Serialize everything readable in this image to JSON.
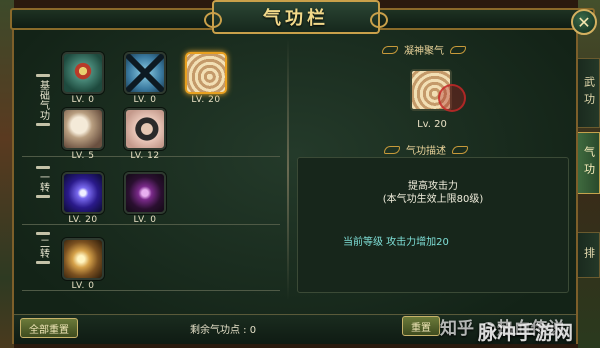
{
  "window": {
    "title": "气功栏",
    "close_icon": "close-icon"
  },
  "left": {
    "sections": [
      {
        "label": "基础气功",
        "skills": [
          {
            "level": "LV. 0",
            "icon": "shield-cross-icon",
            "selected": false
          },
          {
            "level": "LV. 0",
            "icon": "crossed-blades-icon",
            "selected": false
          },
          {
            "level": "LV. 20",
            "icon": "swirl-hand-icon",
            "selected": true
          },
          {
            "level": "LV. 5",
            "icon": "sleeping-figure-icon",
            "selected": false
          },
          {
            "level": "LV. 12",
            "icon": "warrior-portrait-icon",
            "selected": false
          }
        ]
      },
      {
        "label": "一转",
        "skills": [
          {
            "level": "LV. 20",
            "icon": "blue-energy-burst-icon",
            "selected": false
          },
          {
            "level": "LV. 0",
            "icon": "purple-claw-icon",
            "selected": false
          }
        ]
      },
      {
        "label": "二转",
        "skills": [
          {
            "level": "LV. 0",
            "icon": "golden-glow-icon",
            "selected": false
          }
        ]
      }
    ]
  },
  "right": {
    "header_selected": "凝神聚气",
    "selected_level": "Lv. 20",
    "header_desc": "气功描述",
    "desc_title": "提高攻击力",
    "desc_sub": "(本气功生效上限80级)",
    "current_effect": "当前等级  攻击力增加20"
  },
  "bottom": {
    "reset_all": "全部重置",
    "remaining_points": "剩余气功点 : 0",
    "reset": "重置"
  },
  "side_tabs": [
    "武功",
    "气功",
    "排"
  ],
  "watermark": {
    "text1": "知乎 @热血传说",
    "text2": "脉冲手游网"
  }
}
